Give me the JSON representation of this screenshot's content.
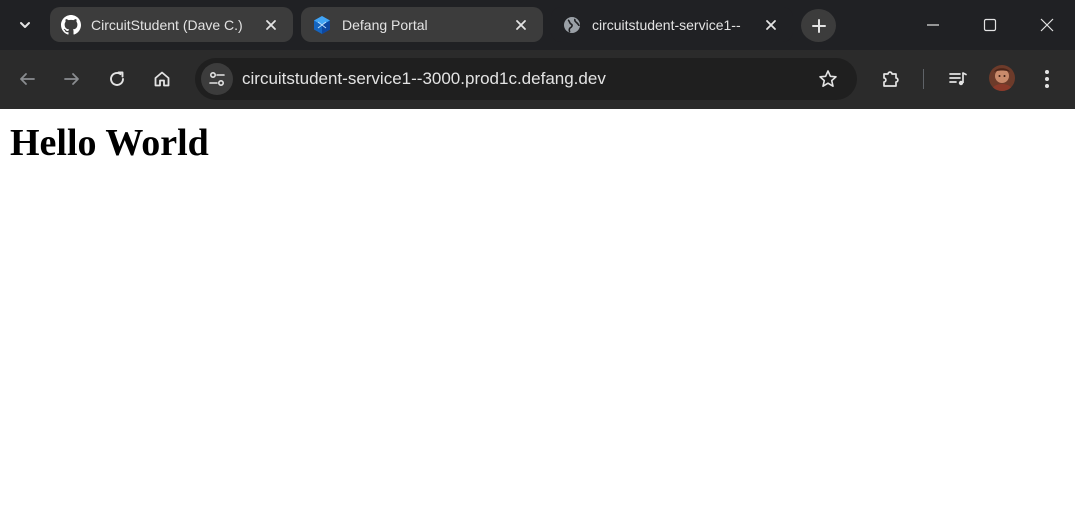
{
  "browser": {
    "tabs": [
      {
        "title": "CircuitStudent (Dave C.)",
        "favicon": "github-icon",
        "active": false
      },
      {
        "title": "Defang Portal",
        "favicon": "defang-icon",
        "active": false
      },
      {
        "title": "circuitstudent-service1--",
        "favicon": "globe-icon",
        "active": true
      }
    ],
    "address_bar": {
      "url": "circuitstudent-service1--3000.prod1c.defang.dev"
    },
    "toolbar_icons": [
      "back-arrow-icon",
      "forward-arrow-icon",
      "reload-icon",
      "home-icon",
      "site-settings-icon",
      "star-icon",
      "extensions-icon",
      "media-controls-icon",
      "profile-avatar",
      "more-menu-icon"
    ],
    "window_controls": [
      "minimize-icon",
      "maximize-icon",
      "close-icon"
    ]
  },
  "page": {
    "heading": "Hello World"
  },
  "colors": {
    "titlebar": "#202124",
    "toolbar": "#2b2b2b",
    "tab": "#3c3c3c",
    "omnibox": "#1f1f1f",
    "icon": "#e3e3e3",
    "page_background": "#ffffff",
    "heading_text": "#000000"
  }
}
